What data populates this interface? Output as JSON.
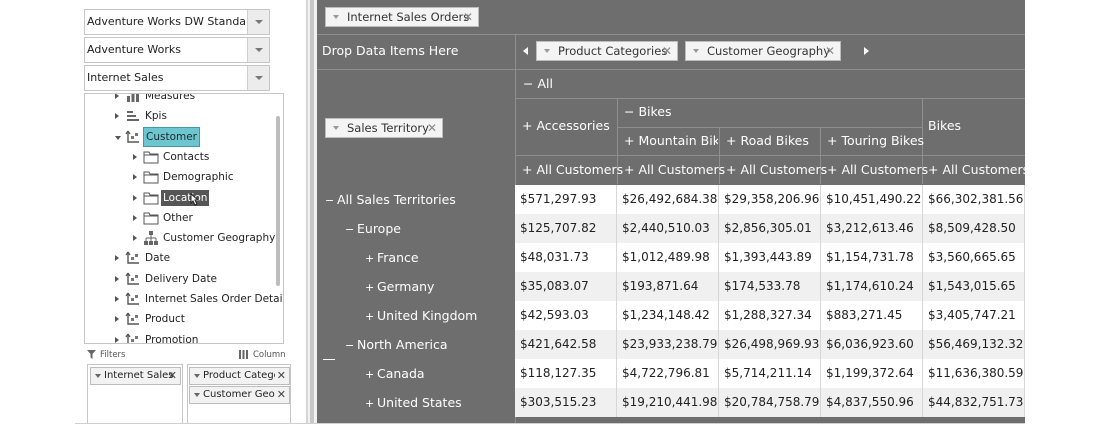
{
  "left_panel": {
    "combos": [
      {
        "value": "Adventure Works DW Standard Edition"
      },
      {
        "value": "Adventure Works"
      },
      {
        "value": "Internet Sales"
      }
    ],
    "tree": [
      {
        "label": "Measures",
        "icon": "measures-icon",
        "level": 0,
        "expand": "closed"
      },
      {
        "label": "Kpis",
        "icon": "kpis-icon",
        "level": 0,
        "expand": "closed"
      },
      {
        "label": "Customer",
        "icon": "dimension-icon",
        "level": 0,
        "expand": "open",
        "state": "selected"
      },
      {
        "label": "Contacts",
        "icon": "folder-icon",
        "level": 1,
        "expand": "closed"
      },
      {
        "label": "Demographic",
        "icon": "folder-icon",
        "level": 1,
        "expand": "closed"
      },
      {
        "label": "Location",
        "icon": "folder-icon",
        "level": 1,
        "expand": "closed",
        "state": "hover"
      },
      {
        "label": "Other",
        "icon": "folder-icon",
        "level": 1,
        "expand": "closed"
      },
      {
        "label": "Customer Geography",
        "icon": "hierarchy-icon",
        "level": 1,
        "expand": "closed"
      },
      {
        "label": "Date",
        "icon": "dimension-icon",
        "level": 0,
        "expand": "closed"
      },
      {
        "label": "Delivery Date",
        "icon": "dimension-icon",
        "level": 0,
        "expand": "closed"
      },
      {
        "label": "Internet Sales Order Details",
        "icon": "dimension-icon",
        "level": 0,
        "expand": "closed"
      },
      {
        "label": "Product",
        "icon": "dimension-icon",
        "level": 0,
        "expand": "closed"
      },
      {
        "label": "Promotion",
        "icon": "dimension-icon",
        "level": 0,
        "expand": "closed"
      }
    ],
    "filters_label": "Filters",
    "columns_label": "Column",
    "filter_chips": [
      "Internet Sales"
    ],
    "column_chips": [
      "Product Categor",
      "Customer Geogr"
    ]
  },
  "pivot": {
    "filter_chip": "Internet Sales Orders",
    "drop_hint": "Drop Data Items Here",
    "column_chips": [
      "Product Categories",
      "Customer Geography"
    ],
    "row_chip": "Sales Territory",
    "col_all": "All",
    "col_accessories": "Accessories",
    "col_bikes": "Bikes",
    "col_mountain": "Mountain Bikes",
    "col_road": "Road Bikes",
    "col_touring": "Touring Bikes",
    "col_bikes_total": "Bikes",
    "col_all_customers": [
      "All Customers",
      "All Customers",
      "All Customers",
      "All Customers",
      "All Customers"
    ],
    "rows": [
      {
        "label": "All Sales Territories",
        "sign": "−",
        "values": [
          "$571,297.93",
          "$26,492,684.38",
          "$29,358,206.96",
          "$10,451,490.22",
          "$66,302,381.56"
        ]
      },
      {
        "label": "Europe",
        "sign": "−",
        "values": [
          "$125,707.82",
          "$2,440,510.03",
          "$2,856,305.01",
          "$3,212,613.46",
          "$8,509,428.50"
        ]
      },
      {
        "label": "France",
        "sign": "+",
        "values": [
          "$48,031.73",
          "$1,012,489.98",
          "$1,393,443.89",
          "$1,154,731.78",
          "$3,560,665.65"
        ]
      },
      {
        "label": "Germany",
        "sign": "+",
        "values": [
          "$35,083.07",
          "$193,871.64",
          "$174,533.78",
          "$1,174,610.24",
          "$1,543,015.65"
        ]
      },
      {
        "label": "United Kingdom",
        "sign": "+",
        "values": [
          "$42,593.03",
          "$1,234,148.42",
          "$1,288,327.34",
          "$883,271.45",
          "$3,405,747.21"
        ]
      },
      {
        "label": "North America",
        "sign": "−",
        "values": [
          "$421,642.58",
          "$23,933,238.79",
          "$26,498,969.93",
          "$6,036,923.60",
          "$56,469,132.32"
        ]
      },
      {
        "label": "Canada",
        "sign": "+",
        "values": [
          "$118,127.35",
          "$4,722,796.81",
          "$5,714,211.14",
          "$1,199,372.64",
          "$11,636,380.59"
        ]
      },
      {
        "label": "United States",
        "sign": "+",
        "values": [
          "$303,515.23",
          "$19,210,441.98",
          "$20,784,758.79",
          "$4,837,550.96",
          "$44,832,751.73"
        ]
      }
    ]
  }
}
